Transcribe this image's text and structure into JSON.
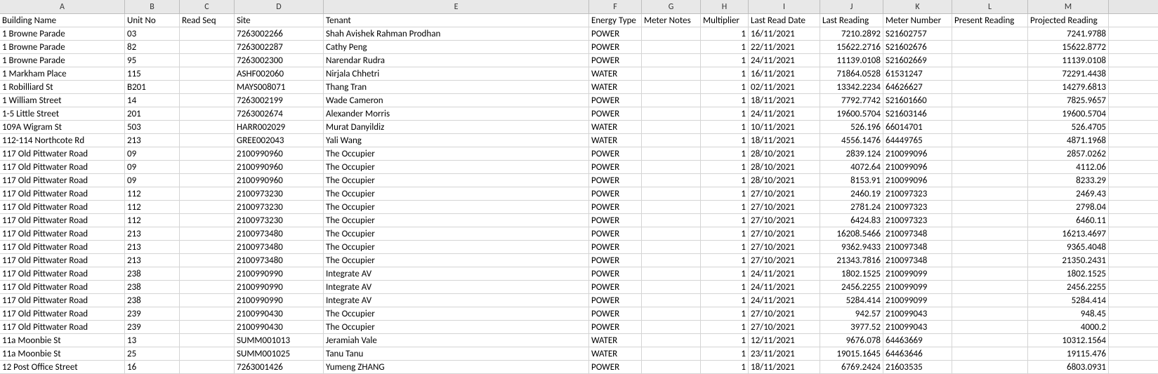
{
  "columns": [
    {
      "id": "A",
      "width": "c-A"
    },
    {
      "id": "B",
      "width": "c-B"
    },
    {
      "id": "C",
      "width": "c-C"
    },
    {
      "id": "D",
      "width": "c-D"
    },
    {
      "id": "E",
      "width": "c-E"
    },
    {
      "id": "F",
      "width": "c-F"
    },
    {
      "id": "G",
      "width": "c-G"
    },
    {
      "id": "H",
      "width": "c-H"
    },
    {
      "id": "I",
      "width": "c-I"
    },
    {
      "id": "J",
      "width": "c-J"
    },
    {
      "id": "K",
      "width": "c-K"
    },
    {
      "id": "L",
      "width": "c-L"
    },
    {
      "id": "M",
      "width": "c-M"
    }
  ],
  "headers": {
    "A": "Building Name",
    "B": "Unit No",
    "C": "Read Seq",
    "D": "Site",
    "E": "Tenant",
    "F": "Energy Type",
    "G": "Meter Notes",
    "H": "Multiplier",
    "I": "Last Read Date",
    "J": "Last Reading",
    "K": "Meter Number",
    "L": "Present Reading",
    "M": "Projected Reading"
  },
  "rows": [
    {
      "A": "1 Browne Parade",
      "B": "03",
      "C": "",
      "D": "7263002266",
      "E": "Shah Avishek Rahman  Prodhan",
      "F": "POWER",
      "G": "",
      "H": "1",
      "I": "16/11/2021",
      "J": "7210.2892",
      "K": "S21602757",
      "L": "",
      "M": "7241.9788"
    },
    {
      "A": "1 Browne Parade",
      "B": "82",
      "C": "",
      "D": "7263002287",
      "E": "Cathy Peng",
      "F": "POWER",
      "G": "",
      "H": "1",
      "I": "22/11/2021",
      "J": "15622.2716",
      "K": "S21602676",
      "L": "",
      "M": "15622.8772"
    },
    {
      "A": "1 Browne Parade",
      "B": "95",
      "C": "",
      "D": "7263002300",
      "E": "Narendar  Rudra",
      "F": "POWER",
      "G": "",
      "H": "1",
      "I": "24/11/2021",
      "J": "11139.0108",
      "K": "S21602669",
      "L": "",
      "M": "11139.0108"
    },
    {
      "A": "1 Markham Place",
      "B": "115",
      "C": "",
      "D": "ASHF002060",
      "E": "Nirjala Chhetri",
      "F": "WATER",
      "G": "",
      "H": "1",
      "I": "16/11/2021",
      "J": "71864.0528",
      "K": "61531247",
      "L": "",
      "M": "72291.4438"
    },
    {
      "A": "1 Robilliard St",
      "B": "B201",
      "C": "",
      "D": "MAYS008071",
      "E": "Thang Tran",
      "F": "WATER",
      "G": "",
      "H": "1",
      "I": "02/11/2021",
      "J": "13342.2234",
      "K": "64626627",
      "L": "",
      "M": "14279.6813"
    },
    {
      "A": "1 William Street",
      "B": "14",
      "C": "",
      "D": "7263002199",
      "E": "Wade Cameron",
      "F": "POWER",
      "G": "",
      "H": "1",
      "I": "18/11/2021",
      "J": "7792.7742",
      "K": "S21601660",
      "L": "",
      "M": "7825.9657"
    },
    {
      "A": "1-5 Little Street",
      "B": "201",
      "C": "",
      "D": "7263002674",
      "E": "Alexander Morris",
      "F": "POWER",
      "G": "",
      "H": "1",
      "I": "24/11/2021",
      "J": "19600.5704",
      "K": "S21603146",
      "L": "",
      "M": "19600.5704"
    },
    {
      "A": "109A Wigram St",
      "B": "503",
      "C": "",
      "D": "HARR002029",
      "E": "Murat Danyildiz",
      "F": "WATER",
      "G": "",
      "H": "1",
      "I": "10/11/2021",
      "J": "526.196",
      "K": "66014701",
      "L": "",
      "M": "526.4705"
    },
    {
      "A": "112-114 Northcote Rd",
      "B": "213",
      "C": "",
      "D": "GREE002043",
      "E": "Yali  Wang",
      "F": "WATER",
      "G": "",
      "H": "1",
      "I": "18/11/2021",
      "J": "4556.1476",
      "K": "64449765",
      "L": "",
      "M": "4871.1968"
    },
    {
      "A": "117 Old Pittwater Road",
      "B": "09",
      "C": "",
      "D": "2100990960",
      "E": "The Occupier",
      "F": "POWER",
      "G": "",
      "H": "1",
      "I": "28/10/2021",
      "J": "2839.124",
      "K": "210099096",
      "L": "",
      "M": "2857.0262"
    },
    {
      "A": "117 Old Pittwater Road",
      "B": "09",
      "C": "",
      "D": "2100990960",
      "E": "The Occupier",
      "F": "POWER",
      "G": "",
      "H": "1",
      "I": "28/10/2021",
      "J": "4072.64",
      "K": "210099096",
      "L": "",
      "M": "4112.06"
    },
    {
      "A": "117 Old Pittwater Road",
      "B": "09",
      "C": "",
      "D": "2100990960",
      "E": "The Occupier",
      "F": "POWER",
      "G": "",
      "H": "1",
      "I": "28/10/2021",
      "J": "8153.91",
      "K": "210099096",
      "L": "",
      "M": "8233.29"
    },
    {
      "A": "117 Old Pittwater Road",
      "B": "112",
      "C": "",
      "D": "2100973230",
      "E": "The Occupier",
      "F": "POWER",
      "G": "",
      "H": "1",
      "I": "27/10/2021",
      "J": "2460.19",
      "K": "210097323",
      "L": "",
      "M": "2469.43"
    },
    {
      "A": "117 Old Pittwater Road",
      "B": "112",
      "C": "",
      "D": "2100973230",
      "E": "The Occupier",
      "F": "POWER",
      "G": "",
      "H": "1",
      "I": "27/10/2021",
      "J": "2781.24",
      "K": "210097323",
      "L": "",
      "M": "2798.04"
    },
    {
      "A": "117 Old Pittwater Road",
      "B": "112",
      "C": "",
      "D": "2100973230",
      "E": "The Occupier",
      "F": "POWER",
      "G": "",
      "H": "1",
      "I": "27/10/2021",
      "J": "6424.83",
      "K": "210097323",
      "L": "",
      "M": "6460.11"
    },
    {
      "A": "117 Old Pittwater Road",
      "B": "213",
      "C": "",
      "D": "2100973480",
      "E": "The Occupier",
      "F": "POWER",
      "G": "",
      "H": "1",
      "I": "27/10/2021",
      "J": "16208.5466",
      "K": "210097348",
      "L": "",
      "M": "16213.4697"
    },
    {
      "A": "117 Old Pittwater Road",
      "B": "213",
      "C": "",
      "D": "2100973480",
      "E": "The Occupier",
      "F": "POWER",
      "G": "",
      "H": "1",
      "I": "27/10/2021",
      "J": "9362.9433",
      "K": "210097348",
      "L": "",
      "M": "9365.4048"
    },
    {
      "A": "117 Old Pittwater Road",
      "B": "213",
      "C": "",
      "D": "2100973480",
      "E": "The Occupier",
      "F": "POWER",
      "G": "",
      "H": "1",
      "I": "27/10/2021",
      "J": "21343.7816",
      "K": "210097348",
      "L": "",
      "M": "21350.2431"
    },
    {
      "A": "117 Old Pittwater Road",
      "B": "238",
      "C": "",
      "D": "2100990990",
      "E": "Integrate AV",
      "F": "POWER",
      "G": "",
      "H": "1",
      "I": "24/11/2021",
      "J": "1802.1525",
      "K": "210099099",
      "L": "",
      "M": "1802.1525"
    },
    {
      "A": "117 Old Pittwater Road",
      "B": "238",
      "C": "",
      "D": "2100990990",
      "E": "Integrate AV",
      "F": "POWER",
      "G": "",
      "H": "1",
      "I": "24/11/2021",
      "J": "2456.2255",
      "K": "210099099",
      "L": "",
      "M": "2456.2255"
    },
    {
      "A": "117 Old Pittwater Road",
      "B": "238",
      "C": "",
      "D": "2100990990",
      "E": "Integrate AV",
      "F": "POWER",
      "G": "",
      "H": "1",
      "I": "24/11/2021",
      "J": "5284.414",
      "K": "210099099",
      "L": "",
      "M": "5284.414"
    },
    {
      "A": "117 Old Pittwater Road",
      "B": "239",
      "C": "",
      "D": "2100990430",
      "E": "The Occupier",
      "F": "POWER",
      "G": "",
      "H": "1",
      "I": "27/10/2021",
      "J": "942.57",
      "K": "210099043",
      "L": "",
      "M": "948.45"
    },
    {
      "A": "117 Old Pittwater Road",
      "B": "239",
      "C": "",
      "D": "2100990430",
      "E": "The Occupier",
      "F": "POWER",
      "G": "",
      "H": "1",
      "I": "27/10/2021",
      "J": "3977.52",
      "K": "210099043",
      "L": "",
      "M": "4000.2"
    },
    {
      "A": "11a Moonbie St",
      "B": "13",
      "C": "",
      "D": "SUMM001013",
      "E": "Jeramiah Vale",
      "F": "WATER",
      "G": "",
      "H": "1",
      "I": "12/11/2021",
      "J": "9676.078",
      "K": "64463669",
      "L": "",
      "M": "10312.1564"
    },
    {
      "A": "11a Moonbie St",
      "B": "25",
      "C": "",
      "D": "SUMM001025",
      "E": "Tanu Tanu",
      "F": "WATER",
      "G": "",
      "H": "1",
      "I": "23/11/2021",
      "J": "19015.1645",
      "K": "64463646",
      "L": "",
      "M": "19115.476"
    },
    {
      "A": "12 Post Office Street",
      "B": "16",
      "C": "",
      "D": "7263001426",
      "E": "Yumeng ZHANG",
      "F": "POWER",
      "G": "",
      "H": "1",
      "I": "18/11/2021",
      "J": "6769.2424",
      "K": "21603535",
      "L": "",
      "M": "6803.0931"
    }
  ],
  "numericCols": [
    "H",
    "J",
    "M"
  ]
}
